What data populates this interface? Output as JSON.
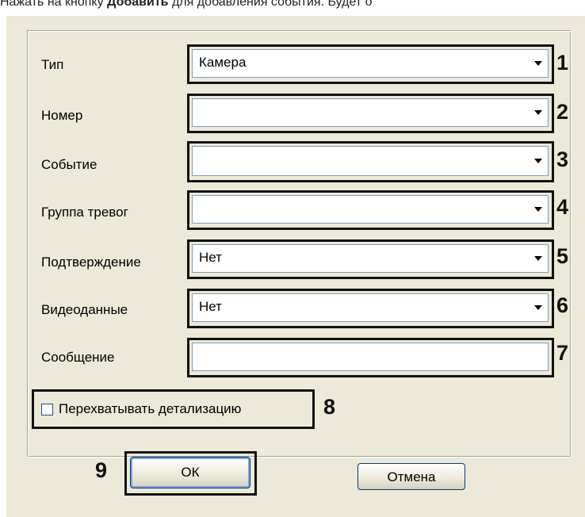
{
  "doc_text": {
    "before": "Нажать на кнопку ",
    "bold": "Добавить",
    "after": " для добавления события. Будет о"
  },
  "form": {
    "rows": [
      {
        "label": "Тип",
        "value": "Камера",
        "type": "select",
        "callout": "1"
      },
      {
        "label": "Номер",
        "value": "",
        "type": "select",
        "callout": "2"
      },
      {
        "label": "Событие",
        "value": "",
        "type": "select",
        "callout": "3"
      },
      {
        "label": "Группа тревог",
        "value": "",
        "type": "select",
        "callout": "4"
      },
      {
        "label": "Подтверждение",
        "value": "Нет",
        "type": "select",
        "callout": "5"
      },
      {
        "label": "Видеоданные",
        "value": "Нет",
        "type": "select",
        "callout": "6"
      },
      {
        "label": "Сообщение",
        "value": "",
        "type": "text",
        "callout": "7"
      }
    ],
    "checkbox": {
      "label": "Перехватывать детализацию",
      "checked": false,
      "callout": "8"
    }
  },
  "buttons": {
    "ok_label": "ОК",
    "cancel_label": "Отмена",
    "callout": "9"
  },
  "colors": {
    "dialog_bg": "#ECE9D8",
    "highlight_border": "#111111",
    "field_border": "#7f9db9"
  }
}
